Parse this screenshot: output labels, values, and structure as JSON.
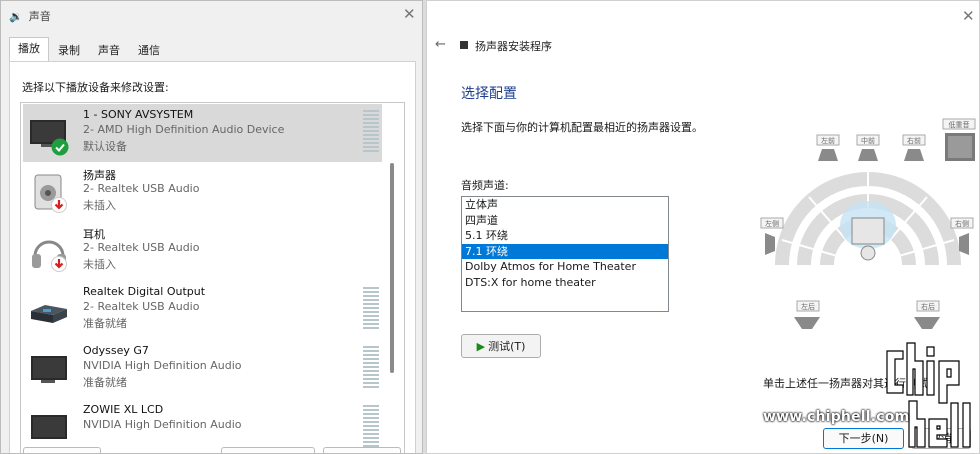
{
  "sound_window": {
    "title": "声音",
    "tabs": [
      "播放",
      "录制",
      "声音",
      "通信"
    ],
    "active_tab": "播放",
    "prompt": "选择以下播放设备来修改设置:",
    "devices": [
      {
        "name": "1 - SONY AVSYSTEM",
        "driver": "2- AMD High Definition Audio Device",
        "status": "默认设备",
        "icon": "tv-monitor-icon",
        "badge": "default-check-icon",
        "selected": true
      },
      {
        "name": "扬声器",
        "driver": "2- Realtek USB Audio",
        "status": "未插入",
        "icon": "speaker-icon",
        "badge": "unplugged-arrow-icon"
      },
      {
        "name": "耳机",
        "driver": "2- Realtek USB Audio",
        "status": "未插入",
        "icon": "headphones-icon",
        "badge": "unplugged-arrow-icon"
      },
      {
        "name": "Realtek Digital Output",
        "driver": "2- Realtek USB Audio",
        "status": "准备就绪",
        "icon": "digital-output-icon"
      },
      {
        "name": "Odyssey G7",
        "driver": "NVIDIA High Definition Audio",
        "status": "准备就绪",
        "icon": "monitor-icon"
      },
      {
        "name": "ZOWIE XL LCD",
        "driver": "NVIDIA High Definition Audio",
        "status": "",
        "icon": "monitor-icon"
      }
    ]
  },
  "wizard": {
    "header": "扬声器安装程序",
    "heading": "选择配置",
    "description": "选择下面与你的计算机配置最相近的扬声器设置。",
    "channels_label": "音频声道:",
    "options": [
      "立体声",
      "四声道",
      "5.1 环绕",
      "7.1 环绕",
      "Dolby Atmos for Home Theater",
      "DTS:X for home theater"
    ],
    "selected_option": "7.1 环绕",
    "test_button": "测试(T)",
    "hint": "单击上述任一扬声器对其进行测试。",
    "next_button": "下一步(N)",
    "cancel_button": "取消",
    "speakers": {
      "fl": "左前",
      "fc": "中前",
      "fr": "右前",
      "sub": "低重音",
      "sl": "左侧",
      "sr": "右侧",
      "bl": "左后",
      "br": "右后"
    }
  },
  "watermark": "www.chiphell.com",
  "colors": {
    "selection": "#0078d7",
    "heading": "#1f3f8f",
    "default_badge": "#1e9e3e",
    "unplugged_badge": "#d42020"
  }
}
